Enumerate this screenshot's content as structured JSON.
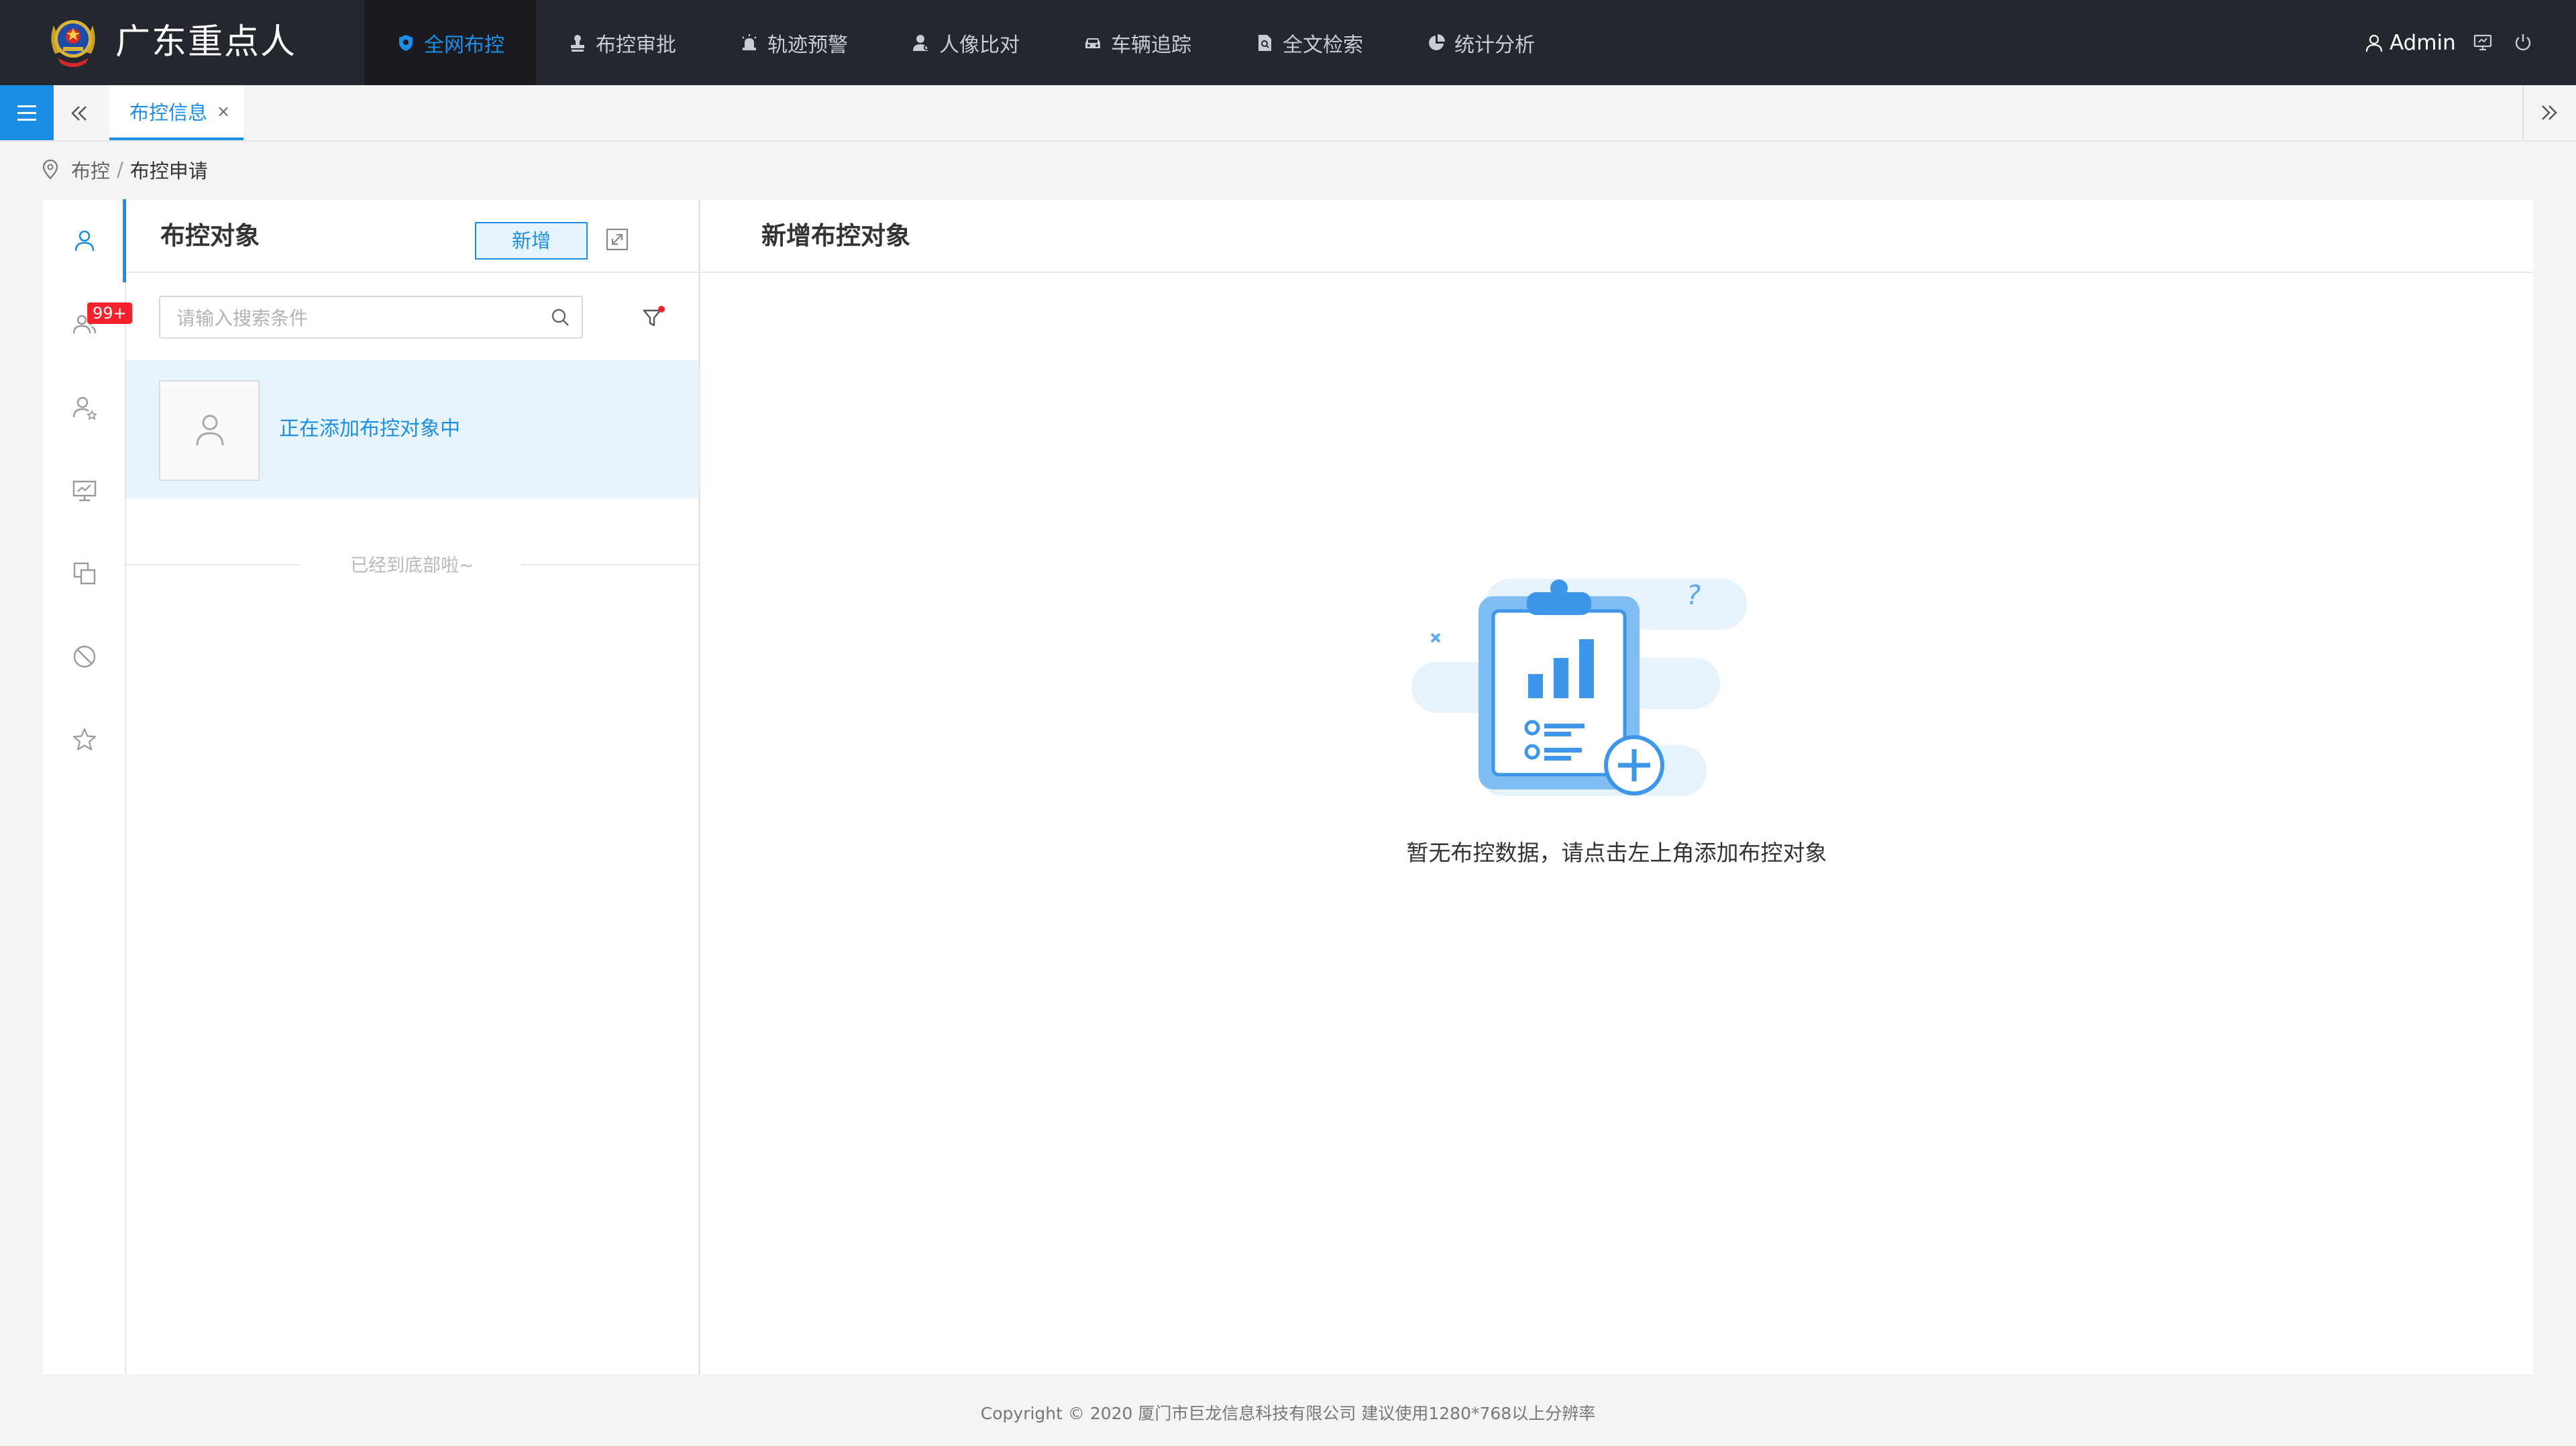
{
  "app": {
    "title": "广东重点人"
  },
  "nav": {
    "items": [
      {
        "label": "全网布控",
        "icon": "shield-icon",
        "active": true
      },
      {
        "label": "布控审批",
        "icon": "stamp-icon"
      },
      {
        "label": "轨迹预警",
        "icon": "alarm-icon"
      },
      {
        "label": "人像比对",
        "icon": "person-icon"
      },
      {
        "label": "车辆追踪",
        "icon": "car-icon"
      },
      {
        "label": "全文检索",
        "icon": "doc-search-icon"
      },
      {
        "label": "统计分析",
        "icon": "pie-chart-icon"
      }
    ],
    "user": "Admin",
    "accent": "#1d8ee6",
    "background": "#24272e"
  },
  "tabs": {
    "active_label": "布控信息",
    "close_glyph": "×"
  },
  "breadcrumb": {
    "root": "布控",
    "separator": "/",
    "current": "布控申请"
  },
  "rail": {
    "items": [
      "person-icon",
      "group-icon",
      "person-star-icon",
      "monitor-chart-icon",
      "copy-icon",
      "ban-icon",
      "star-icon"
    ],
    "badge": "99+"
  },
  "list_panel": {
    "title": "布控对象",
    "add_label": "新增",
    "search_placeholder": "请输入搜索条件",
    "items": [
      {
        "label": "正在添加布控对象中"
      }
    ],
    "end_text": "已经到底部啦~"
  },
  "detail": {
    "title": "新增布控对象",
    "empty_text": "暂无布控数据，请点击左上角添加布控对象"
  },
  "footer": {
    "text": "Copyright © 2020  厦门市巨龙信息科技有限公司  建议使用1280*768以上分辨率"
  }
}
